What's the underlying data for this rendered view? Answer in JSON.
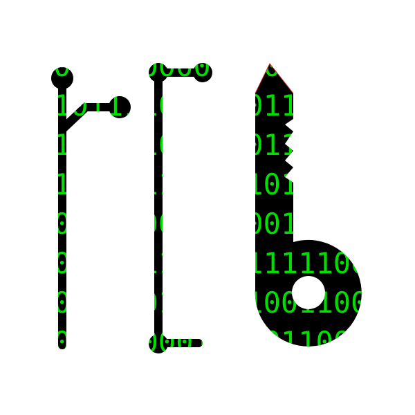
{
  "colors": {
    "background": "#ffffff",
    "shape_fill": "#000000",
    "digits": "#00e000",
    "edge": "#cc2222"
  },
  "icon": "circuit-key-icon",
  "binary_rows": [
    "0",
    "10111",
    "10111",
    "11011",
    "00011",
    "00111111",
    "00110011",
    "00011"
  ]
}
